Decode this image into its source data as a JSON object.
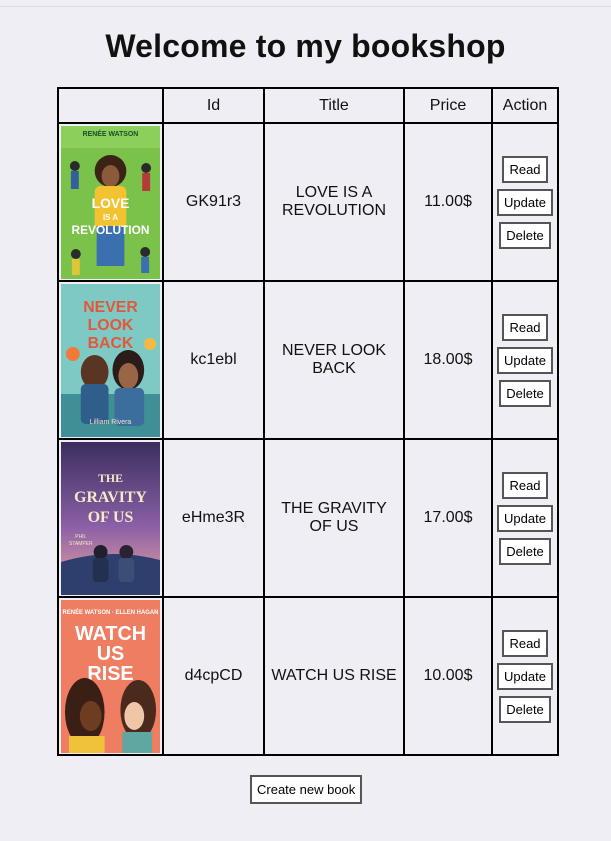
{
  "page": {
    "title": "Welcome to my bookshop"
  },
  "table": {
    "headers": [
      "",
      "Id",
      "Title",
      "Price",
      "Action"
    ],
    "rows": [
      {
        "id": "GK91r3",
        "title": "LOVE IS A REVOLUTION",
        "price": "11.00$",
        "cover_author": "RENÉE WATSON",
        "cover_title": "LOVE IS A REVOLUTION"
      },
      {
        "id": "kc1ebl",
        "title": "NEVER LOOK BACK",
        "price": "18.00$",
        "cover_author": "Lilliam Rivera",
        "cover_title": "NEVER LOOK BACK"
      },
      {
        "id": "eHme3R",
        "title": "THE GRAVITY OF US",
        "price": "17.00$",
        "cover_author": "PHIL STAMPER",
        "cover_title": "THE GRAVITY OF US"
      },
      {
        "id": "d4cpCD",
        "title": "WATCH US RISE",
        "price": "10.00$",
        "cover_author": "RENÉE WATSON · ELLEN HAGAN",
        "cover_title": "WATCH US RISE"
      }
    ],
    "actions": {
      "read": "Read",
      "update": "Update",
      "delete": "Delete"
    }
  },
  "create_button": "Create new book"
}
